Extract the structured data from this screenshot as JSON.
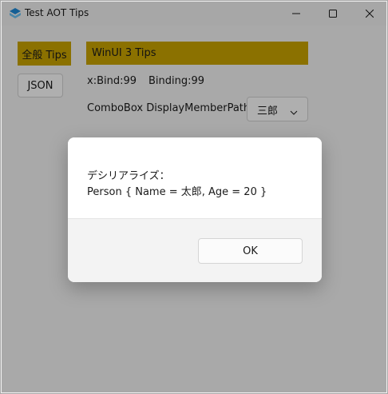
{
  "window": {
    "title": "Test AOT Tips",
    "icon": "app-logo-icon",
    "controls": [
      "minimize-icon",
      "maximize-icon",
      "close-icon"
    ]
  },
  "nav": {
    "general_label": "全般 Tips",
    "json_label": "JSON"
  },
  "main": {
    "header": "WinUI 3 Tips",
    "xbind_text": "x:Bind:99",
    "binding_text": "Binding:99",
    "combobox_label": "ComboBox DisplayMemberPath:",
    "combobox_value": "三郎"
  },
  "dialog": {
    "line1": "デシリアライズ：",
    "line2": "Person { Name = 太郎, Age = 20 }",
    "ok_label": "OK"
  },
  "colors": {
    "accent_yellow": "#c8a200",
    "app_icon_blue": "#1e88d6"
  }
}
